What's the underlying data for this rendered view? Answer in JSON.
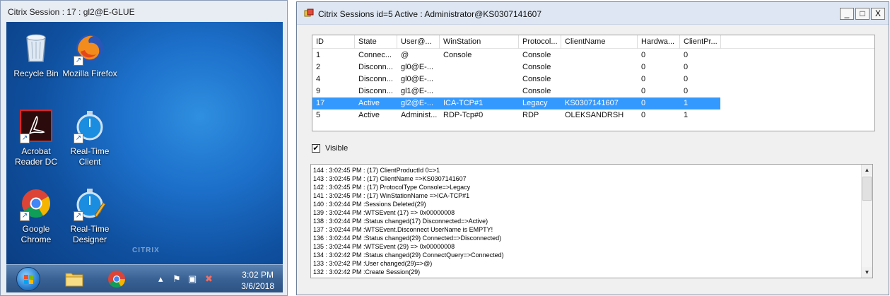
{
  "citrix_window": {
    "title": "Citrix Session : 17 : gl2@E-GLUE",
    "watermark": "CITRIX",
    "desktop_icons": [
      {
        "label": "Recycle Bin",
        "icon": "recycle-bin-icon"
      },
      {
        "label": "Mozilla Firefox",
        "icon": "firefox-icon"
      },
      {
        "label": "Acrobat Reader DC",
        "icon": "acrobat-icon"
      },
      {
        "label": "Real-Time Client",
        "icon": "stopwatch-icon"
      },
      {
        "label": "Google Chrome",
        "icon": "chrome-icon"
      },
      {
        "label": "Real-Time Designer",
        "icon": "stopwatch-pencil-icon"
      }
    ],
    "taskbar": {
      "clock_time": "3:02 PM",
      "clock_date": "3/6/2018"
    }
  },
  "app_window": {
    "title": "Citrix Sessions id=5 Active : Administrator@KS0307141607",
    "controls": {
      "minimize": "_",
      "maximize": "□",
      "close": "X"
    },
    "columns": [
      "ID",
      "State",
      "User@...",
      "WinStation",
      "Protocol...",
      "ClientName",
      "Hardwa...",
      "ClientPr..."
    ],
    "rows": [
      {
        "cells": [
          "1",
          "Connec...",
          "@",
          "Console",
          "Console",
          "",
          "0",
          "0"
        ],
        "selected": false
      },
      {
        "cells": [
          "2",
          "Disconn...",
          "gl0@E-...",
          "",
          "Console",
          "",
          "0",
          "0"
        ],
        "selected": false
      },
      {
        "cells": [
          "4",
          "Disconn...",
          "gl0@E-...",
          "",
          "Console",
          "",
          "0",
          "0"
        ],
        "selected": false
      },
      {
        "cells": [
          "9",
          "Disconn...",
          "gl1@E-...",
          "",
          "Console",
          "",
          "0",
          "0"
        ],
        "selected": false
      },
      {
        "cells": [
          "17",
          "Active",
          "gl2@E-...",
          "ICA-TCP#1",
          "Legacy",
          "KS0307141607",
          "0",
          "1"
        ],
        "selected": true
      },
      {
        "cells": [
          "5",
          "Active",
          "Administ...",
          "RDP-Tcp#0",
          "RDP",
          "OLEKSANDRSH",
          "0",
          "1"
        ],
        "selected": false
      }
    ],
    "visible_checkbox": {
      "label": "Visible",
      "checked": "✔"
    },
    "log_lines": [
      "144 : 3:02:45 PM : (17) ClientProductId 0=>1",
      "143 : 3:02:45 PM : (17) ClientName =>KS0307141607",
      "142 : 3:02:45 PM : (17) ProtocolType Console=>Legacy",
      "141 : 3:02:45 PM : (17) WinStationName =>ICA-TCP#1",
      "140 : 3:02:44 PM :Sessions Deleted(29)",
      "139 : 3:02:44 PM :WTSEvent (17) => 0x00000008",
      "138 : 3:02:44 PM :Status changed(17) Disconnected=>Active)",
      "137 : 3:02:44 PM :WTSEvent.Disconnect UserName is EMPTY!",
      "136 : 3:02:44 PM :Status changed(29) Connected=>Disconnected)",
      "135 : 3:02:44 PM :WTSEvent (29) => 0x00000008",
      "134 : 3:02:42 PM :Status changed(29) ConnectQuery=>Connected)",
      "133 : 3:02:42 PM :User changed(29)=>@)",
      "132 : 3:02:42 PM :Create Session(29)"
    ]
  }
}
